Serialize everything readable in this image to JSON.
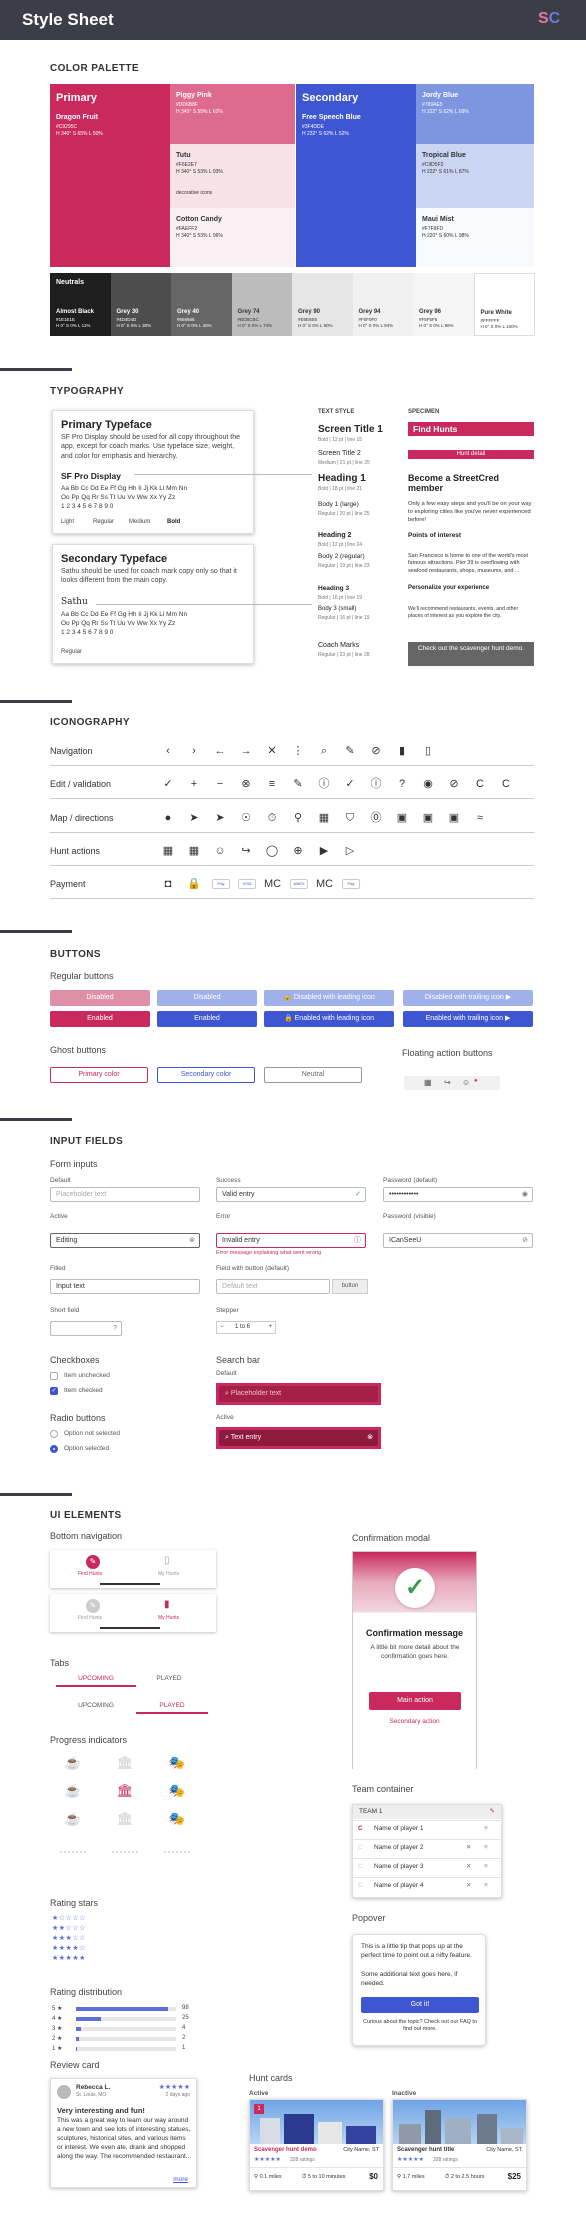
{
  "header": {
    "title": "Style Sheet",
    "logo_s": "S",
    "logo_c": "C"
  },
  "color_palette": {
    "title": "COLOR PALETTE",
    "primary": {
      "label": "Primary",
      "name": "Dragon Fruit",
      "hex": "#C9295C",
      "hsl": "H 340° S 65% L 50%",
      "color": "#c9295c"
    },
    "primary_tints": [
      {
        "name": "Piggy Pink",
        "hex": "#DD6B8F",
        "hsl": "H 340° S 55% L 62%",
        "color": "#dd6b8f",
        "extra": ""
      },
      {
        "name": "Tutu",
        "hex": "#F6E2E7",
        "hsl": "H 340° S 53% L 93%",
        "color": "#f6e2e7",
        "extra": "decorative icons"
      },
      {
        "name": "Cotton Candy",
        "hex": "#FAEFF2",
        "hsl": "H 340° S 53% L 96%",
        "color": "#faeff2",
        "extra": ""
      }
    ],
    "secondary": {
      "label": "Secondary",
      "name": "Free Speech Blue",
      "hex": "#3F4DDE",
      "hsl": "H 232° S 62% L 52%",
      "color": "#3f56d2"
    },
    "secondary_tints": [
      {
        "name": "Jordy Blue",
        "hex": "#789AE5",
        "hsl": "H 222° S 62% L 69%",
        "color": "#7e95df"
      },
      {
        "name": "Tropical Blue",
        "hex": "#C9D5F2",
        "hsl": "H 222° S 61% L 87%",
        "color": "#c9d5f2"
      },
      {
        "name": "Maui Mist",
        "hex": "#F7F9FD",
        "hsl": "H 220° S 60% L 98%",
        "color": "#f7f9fd"
      }
    ],
    "neutrals_label": "Neutrals",
    "neutrals": [
      {
        "name": "Almost Black",
        "hex": "#1E1E1E",
        "hsl": "H 0° S 0% L 11%",
        "color": "#1e1e1e",
        "dark": true
      },
      {
        "name": "Grey 30",
        "hex": "#4D4D4D",
        "hsl": "H 0° S 0% L 30%",
        "color": "#4d4d4d",
        "dark": true
      },
      {
        "name": "Grey 40",
        "hex": "#666666",
        "hsl": "H 0° S 0% L 40%",
        "color": "#666666",
        "dark": true
      },
      {
        "name": "Grey 74",
        "hex": "#BCBCBC",
        "hsl": "H 0° S 0% L 74%",
        "color": "#bcbcbc",
        "dark": false
      },
      {
        "name": "Grey 90",
        "hex": "#E6E6E6",
        "hsl": "H 0° S 0% L 90%",
        "color": "#e6e6e6",
        "dark": false
      },
      {
        "name": "Grey 94",
        "hex": "#F0F0F0",
        "hsl": "H 0° S 0% L 94%",
        "color": "#f0f0f0",
        "dark": false
      },
      {
        "name": "Grey 96",
        "hex": "#F5F5F5",
        "hsl": "H 0° S 0% L 96%",
        "color": "#f5f5f5",
        "dark": false
      },
      {
        "name": "Pure White",
        "hex": "#FFFFFF",
        "hsl": "H 0° S 0% L 100%",
        "color": "#ffffff",
        "dark": false
      }
    ]
  },
  "typography": {
    "title": "TYPOGRAPHY",
    "primary_typeface": {
      "title": "Primary Typeface",
      "desc": "SF Pro Display should be used for all copy throughout the app, except for coach marks. Use typeface size, weight, and color for emphasis and hierarchy.",
      "font_name": "SF Pro Display",
      "alphabet1": "Aa Bb Cc Dd Ee Ff Gg Hh Ii Jj Kk Ll Mm Nn",
      "alphabet2": "Oo Pp Qq Rr Ss Tt Uu Vv Ww Xx Yy Zz",
      "digits": "1 2 3 4 5 6 7 8 9 0",
      "weights": [
        "Light",
        "Regular",
        "Medium",
        "Bold"
      ]
    },
    "secondary_typeface": {
      "title": "Secondary Typeface",
      "desc": "Sathu should be used for coach mark copy only so that it looks different from the main copy.",
      "font_name": "Sathu",
      "alphabet1": "Aa Bb Cc Dd Ee Ff Gg Hh Ii Jj Kk Ll Mm Nn",
      "alphabet2": "Oo Pp Qq Rr Ss Tt Uu Vv Ww Xx Yy Zz",
      "digits": "1 2 3 4 5 6 7 8 9 0",
      "weights": [
        "Regular"
      ]
    },
    "text_style_header": "TEXT STYLE",
    "specimen_header": "SPECIMEN",
    "styles": [
      {
        "name": "Screen Title 1",
        "meta": "Bold | 12 pt | line 15"
      },
      {
        "name": "Screen Title 2",
        "meta": "Medium | 21 pt | line 25"
      },
      {
        "name": "Heading 1",
        "meta": "Bold | 18 pt | line 21"
      },
      {
        "name": "Body 1 (large)",
        "meta": "Regular | 20 pt | line 25"
      },
      {
        "name": "Heading 2",
        "meta": "Bold | 12 pt | line 24"
      },
      {
        "name": "Body 2 (regular)",
        "meta": "Regular | 19 pt | line 23"
      },
      {
        "name": "Heading 3",
        "meta": "Bold | 16 pt | line 19"
      },
      {
        "name": "Body 3 (small)",
        "meta": "Regular | 16 pt | line 19"
      },
      {
        "name": "Coach Marks",
        "meta": "Regular | 23 pt | line 28"
      }
    ],
    "specimen": {
      "find_hunts": "Find Hunts",
      "hunt_detail": "Hunt detail",
      "heading": "Become a StreetCred member",
      "body1": "Only a few easy steps and you'll be on your way to exploring cities like you've never experienced before!",
      "h2": "Points of interest",
      "body2": "San Francisco is home to one of the world's most famous attractions. Pier 39 is overflowing with seafood restaurants, shops, museums, and ...",
      "h3": "Personalize your experience",
      "body3": "We'll recommend restaurants, events, and other places of interest as you explore the city.",
      "coach": "Check out the scavenger hunt demo."
    }
  },
  "iconography": {
    "title": "ICONOGRAPHY",
    "rows": [
      {
        "label": "Navigation",
        "icons": [
          "‹",
          "›",
          "←",
          "→",
          "✕",
          "⋮",
          "⌕",
          "✎",
          "⊘",
          "▮",
          "▯"
        ]
      },
      {
        "label": "Edit / validation",
        "icons": [
          "✓",
          "+",
          "−",
          "⊗",
          "≡",
          "✎",
          "ⓘ",
          "✓",
          "ⓘ",
          "?",
          "◉",
          "⊘",
          "C",
          "C"
        ]
      },
      {
        "label": "Map / directions",
        "icons": [
          "●",
          "➤",
          "➤",
          "☉",
          "⏱",
          "⚲",
          "▦",
          "⛉",
          "⓪",
          "▣",
          "▣",
          "▣",
          "≈"
        ]
      },
      {
        "label": "Hunt actions",
        "icons": [
          "▦",
          "▦",
          "☺",
          "↪",
          "◯",
          "⊕",
          "▶",
          "▷"
        ]
      },
      {
        "label": "Payment",
        "icons": [
          "◘",
          "🔒",
          "Pay",
          "VISA",
          "MC",
          "AMEX",
          "MC",
          "Pay"
        ]
      }
    ]
  },
  "buttons": {
    "title": "BUTTONS",
    "regular_title": "Regular buttons",
    "disabled": "Disabled",
    "enabled": "Enabled",
    "disabled_leading": "Disabled with leading icon",
    "enabled_leading": "Enabled with leading icon",
    "disabled_trailing": "Disabled with trailing icon",
    "enabled_trailing": "Enabled with trailing icon",
    "ghost_title": "Ghost buttons",
    "ghost_primary": "Primary color",
    "ghost_secondary": "Secondary color",
    "ghost_neutral": "Neutral",
    "fab_title": "Floating action buttons"
  },
  "inputs": {
    "title": "INPUT FIELDS",
    "forms_title": "Form inputs",
    "default_label": "Default",
    "default_placeholder": "Placeholder text",
    "success_label": "Success",
    "success_value": "Valid entry",
    "pw_default_label": "Password (default)",
    "pw_default_value": "••••••••••••",
    "active_label": "Active",
    "active_value": "Editing",
    "error_label": "Error",
    "error_value": "Invalid entry",
    "error_msg": "Error message explaining what went wrong",
    "pw_visible_label": "Password (visible)",
    "pw_visible_value": "ICanSeeU",
    "filled_label": "Filled",
    "filled_value": "Input text",
    "fwb_label": "Field with button (default)",
    "fwb_placeholder": "Default text",
    "fwb_button": "button",
    "short_label": "Short field",
    "stepper_label": "Stepper",
    "stepper_value": "1 to 6",
    "checkboxes_title": "Checkboxes",
    "item_unchecked": "Item unchecked",
    "item_checked": "Item checked",
    "radio_title": "Radio buttons",
    "opt_not": "Option not selected",
    "opt_sel": "Option selected",
    "search_title": "Search bar",
    "search_default": "Default",
    "search_placeholder": "Placeholder text",
    "search_active": "Active",
    "search_value": "Text entry"
  },
  "ui": {
    "title": "UI ELEMENTS",
    "bottom_nav_title": "Bottom navigation",
    "nav_find": "Find Hunts",
    "nav_my": "My Hunts",
    "tabs_title": "Tabs",
    "tab_upcoming": "UPCOMING",
    "tab_played": "PLAYED",
    "progress_title": "Progress indicators",
    "stars_title": "Rating stars",
    "dist_title": "Rating distribution",
    "dist": [
      {
        "label": "5 ★",
        "count": 98,
        "frac": 0.92
      },
      {
        "label": "4 ★",
        "count": 25,
        "frac": 0.25
      },
      {
        "label": "3 ★",
        "count": 4,
        "frac": 0.05
      },
      {
        "label": "2 ★",
        "count": 2,
        "frac": 0.03
      },
      {
        "label": "1 ★",
        "count": 1,
        "frac": 0.01
      }
    ],
    "review_title": "Review card",
    "review": {
      "name": "Rebecca L.",
      "place": "St. Louis, MO",
      "date": "2 days ago",
      "stars": "★★★★★",
      "headline": "Very interesting and fun!",
      "body": "This was a great way to learn our way around a new town and see lots of interesting statues, sculptures, historical sites, and various items or interest. We even ate, drank and shopped along the way. The recommended restaurant...",
      "more": "more"
    },
    "modal_title": "Confirmation modal",
    "modal_heading": "Confirmation message",
    "modal_body": "A little bit more detail about the confirmation goes here.",
    "modal_main": "Main action",
    "modal_secondary": "Secondary action",
    "team_title": "Team container",
    "team_header": "TEAM 1",
    "players": [
      "Name of player 1",
      "Name of player 2",
      "Name of player 3",
      "Name of player 4"
    ],
    "popover_title": "Popover",
    "popover_p1": "This is a little tip that pops up at the perfect time to point out a nifty feature.",
    "popover_p2": "Some additional text goes here, if needed.",
    "popover_btn": "Got it!",
    "popover_foot": "Curious about the topic? Check out our FAQ to find out more.",
    "hunt_title": "Hunt cards",
    "hunt_active": "Active",
    "hunt_inactive": "Inactive",
    "hunt_a": {
      "name": "Scavenger hunt demo",
      "city": "City Name, ST",
      "stars": "★★★★★",
      "ratings": "328 ratings",
      "miles": "0.1 miles",
      "time": "5 to 10 minutes",
      "price": "$0"
    },
    "hunt_b": {
      "name": "Scavenger hunt title",
      "city": "City Name, ST",
      "stars": "★★★★★",
      "ratings": "328 ratings",
      "miles": "1.7 miles",
      "time": "2 to 2.5 hours",
      "price": "$25"
    }
  }
}
